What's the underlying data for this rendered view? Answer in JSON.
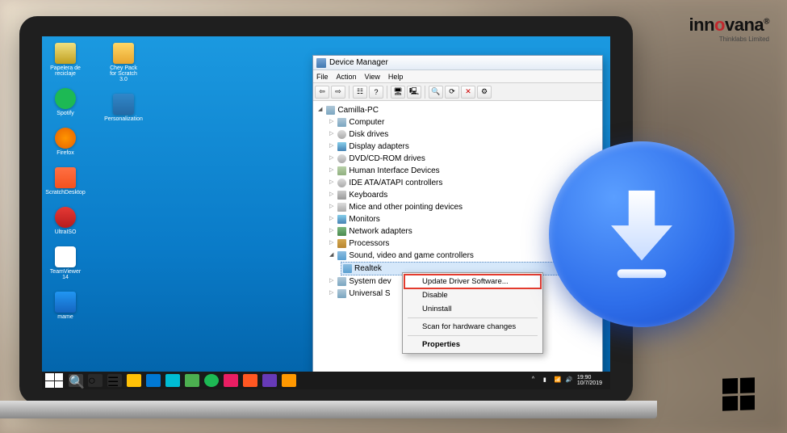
{
  "logo": {
    "name": "innovana",
    "tagline": "Thinklabs Limited"
  },
  "window": {
    "title": "Device Manager",
    "menus": [
      "File",
      "Action",
      "View",
      "Help"
    ],
    "root": "Camilla-PC",
    "categories": [
      {
        "label": "Computer",
        "icon": "pc"
      },
      {
        "label": "Disk drives",
        "icon": "disk"
      },
      {
        "label": "Display adapters",
        "icon": "monitor"
      },
      {
        "label": "DVD/CD-ROM drives",
        "icon": "disk"
      },
      {
        "label": "Human Interface Devices",
        "icon": "hid"
      },
      {
        "label": "IDE ATA/ATAPI controllers",
        "icon": "disk"
      },
      {
        "label": "Keyboards",
        "icon": "keyb"
      },
      {
        "label": "Mice and other pointing devices",
        "icon": "mouse"
      },
      {
        "label": "Monitors",
        "icon": "monitor"
      },
      {
        "label": "Network adapters",
        "icon": "net"
      },
      {
        "label": "Processors",
        "icon": "cpu"
      },
      {
        "label": "Sound, video and game controllers",
        "icon": "sound",
        "expanded": true,
        "child": "Realtek"
      },
      {
        "label": "System dev",
        "icon": "pc"
      },
      {
        "label": "Universal S",
        "icon": "pc"
      }
    ]
  },
  "context_menu": {
    "items": [
      {
        "label": "Update Driver Software...",
        "highlighted": true
      },
      {
        "label": "Disable"
      },
      {
        "label": "Uninstall"
      },
      {
        "sep": true
      },
      {
        "label": "Scan for hardware changes"
      },
      {
        "sep": true
      },
      {
        "label": "Properties",
        "bold": true
      }
    ]
  },
  "desktop_icons": [
    {
      "label": "Papelera de reciclaje",
      "class": "recycle"
    },
    {
      "label": "Spotify",
      "class": "spotify"
    },
    {
      "label": "Firefox",
      "class": "firefox"
    },
    {
      "label": "ScratchDesktop",
      "class": "scratch"
    },
    {
      "label": "UltraISO",
      "class": "iso"
    },
    {
      "label": "TeamViewer 14",
      "class": "tv"
    },
    {
      "label": "mame",
      "class": "mame"
    },
    {
      "label": "Chey Pack for Scratch 3.0",
      "class": "folder"
    },
    {
      "label": "Personalization",
      "class": "personal"
    }
  ],
  "taskbar": {
    "time": "19:90",
    "date": "10/7/2019"
  }
}
